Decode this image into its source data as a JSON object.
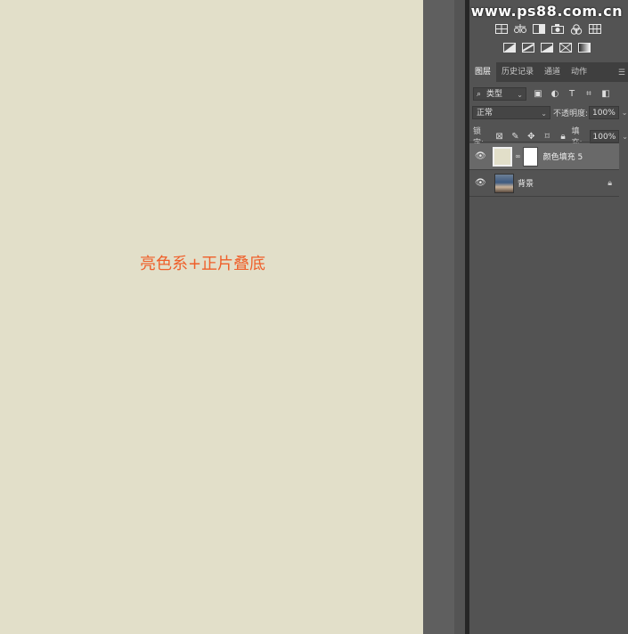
{
  "canvas": {
    "caption": "亮色系+正片叠底",
    "background": "#e2dfc9",
    "caption_color": "#ef5f2a"
  },
  "watermark": "www.ps88.com.cn",
  "toolbar_rows": [
    [
      "levels-icon",
      "balance-icon",
      "black-white-icon",
      "camera-icon",
      "channel-mixer-icon",
      "grid-icon"
    ],
    [
      "invert-icon",
      "posterize-icon",
      "threshold-icon",
      "selective-color-icon",
      "gradient-map-icon"
    ]
  ],
  "tabs": [
    "图层",
    "历史记录",
    "通道",
    "动作"
  ],
  "filter": {
    "kind": "类型"
  },
  "blend": {
    "mode": "正常",
    "opacity_label": "不透明度:",
    "opacity": "100%"
  },
  "lock": {
    "label": "锁定:",
    "fill_label": "填充:",
    "fill": "100%"
  },
  "layers": [
    {
      "name": "颜色填充 5",
      "selected": true
    },
    {
      "name": "背景",
      "selected": false,
      "locked": true
    }
  ]
}
